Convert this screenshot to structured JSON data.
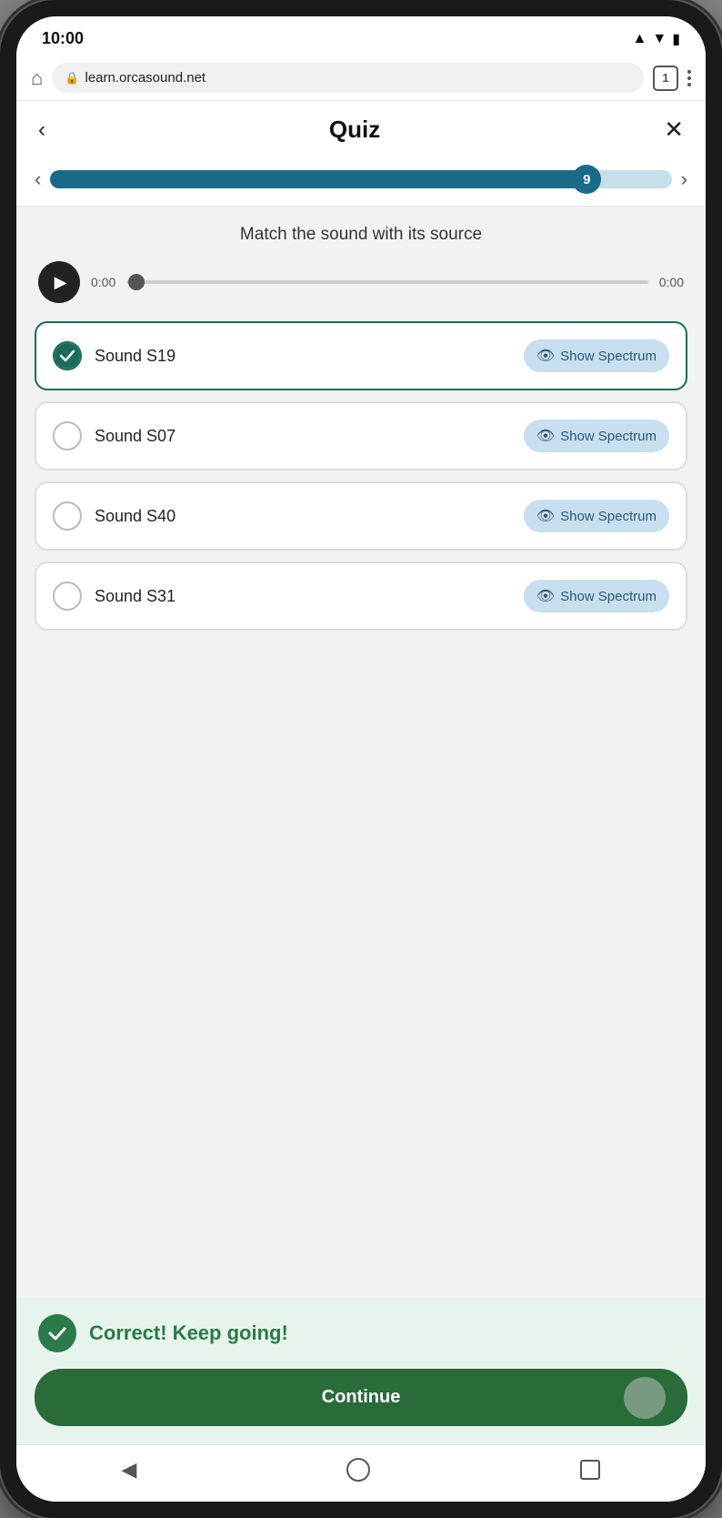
{
  "status_bar": {
    "time": "10:00",
    "tab_count": "1"
  },
  "browser": {
    "url": "learn.orcasound.net"
  },
  "quiz": {
    "title": "Quiz",
    "question": "Match the sound with its source",
    "progress": {
      "step": "9",
      "fill_percent": "88%"
    },
    "audio": {
      "time_left": "0:00",
      "time_right": "0:00"
    },
    "options": [
      {
        "id": "s19",
        "label": "Sound S19",
        "selected": true,
        "show_spectrum_label": "Show Spectrum"
      },
      {
        "id": "s07",
        "label": "Sound S07",
        "selected": false,
        "show_spectrum_label": "Show Spectrum"
      },
      {
        "id": "s40",
        "label": "Sound S40",
        "selected": false,
        "show_spectrum_label": "Show Spectrum"
      },
      {
        "id": "s31",
        "label": "Sound S31",
        "selected": false,
        "show_spectrum_label": "Show Spectrum"
      }
    ],
    "correct_message": "Correct! Keep going!",
    "continue_label": "Continue"
  }
}
